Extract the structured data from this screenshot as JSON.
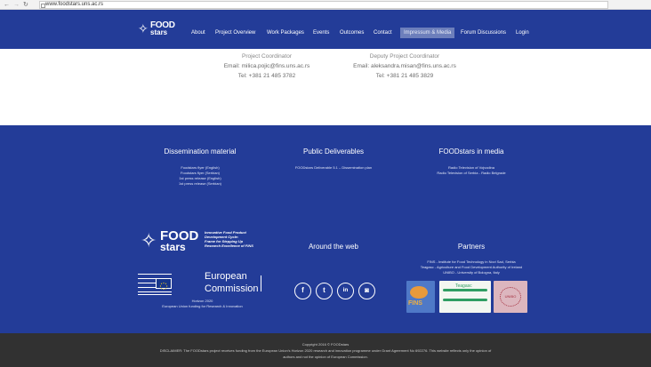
{
  "browser": {
    "back_icon": "arrow-left-icon",
    "forward_icon": "arrow-right-icon",
    "reload_icon": "reload-icon",
    "url": "www.foodstars.uns.ac.rs"
  },
  "navbar": {
    "logo": {
      "line1": "FOOD",
      "line2": "stars"
    },
    "items": [
      "About",
      "Project Overview",
      "Work Packages",
      "Events",
      "Outcomes",
      "Contact",
      "Impressum & Media",
      "Forum Discussions",
      "Login"
    ],
    "active_item": "Impressum & Media",
    "background": "#233c98"
  },
  "contacts": [
    {
      "role": "Project Coordinator",
      "email": "Email: milica.pojic@fins.uns.ac.rs",
      "phone": "Tel: +381 21 485 3782"
    },
    {
      "role": "Deputy Project Coordinator",
      "email": "Email: aleksandra.misan@fins.uns.ac.rs",
      "phone": "Tel: +381 21 485 3829"
    }
  ],
  "footer": {
    "dissemination": {
      "title": "Dissemination material",
      "links": [
        "Foodstars flyer (English)",
        "Foodstars flyer (Serbian)",
        "1st press release (English)",
        "1st press release (Serbian)"
      ]
    },
    "deliverables": {
      "title": "Public Deliverables",
      "links": [
        "FOODstars Deliverable 5.1 – Dissemination plan"
      ]
    },
    "media": {
      "title": "FOODstars in media",
      "links": [
        "Radio Television of Vojvodina",
        "Radio Television of Serbia - Radio Belgrade"
      ]
    },
    "logo": {
      "line1": "FOOD",
      "line2": "stars",
      "tagline": [
        "Innovative Food Product",
        "Development Cycle:",
        "Frame for Stepping Up",
        "Research Excellence of FINS"
      ]
    },
    "eu": {
      "word1": "European",
      "word2": "Commission",
      "sub1": "Horizon 2020",
      "sub2": "European Union funding for Research & Innovation"
    },
    "around_web": {
      "title": "Around the web",
      "icons": [
        {
          "name": "facebook-icon",
          "glyph": "f"
        },
        {
          "name": "twitter-icon",
          "glyph": "t"
        },
        {
          "name": "linkedin-icon",
          "glyph": "in"
        },
        {
          "name": "instagram-icon",
          "glyph": "◙"
        }
      ]
    },
    "partners": {
      "title": "Partners",
      "lines": [
        "FINS - Institute for Food Technology in Novi Sad, Serbia",
        "Teagasc - Agriculture and Food Development Authority of Ireland",
        "UNIBO - University of Bologna, Italy"
      ],
      "logo_names": [
        "FINS",
        "Teagasc",
        "UNIBO"
      ]
    }
  },
  "bottom": {
    "copyright": "Copyright 2016 © FOODstars",
    "disclaimer1": "DISCLAIMER: The FOODstars project receives funding from the European Union's Horizon 2020 research and innovation programme under Grant Agreement No 692276. This website reflects only the opinion of",
    "disclaimer2": "authors and not the opinion of European Commission."
  }
}
